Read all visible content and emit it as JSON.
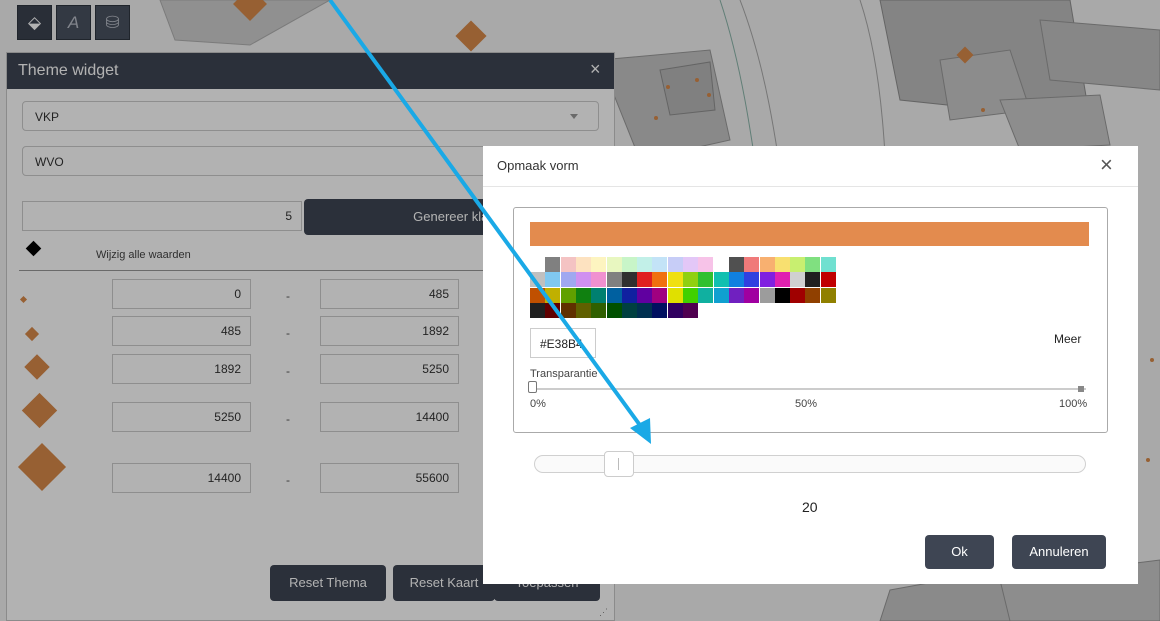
{
  "toolbar": {
    "icons": [
      "theme-icon",
      "label-icon",
      "database-icon"
    ]
  },
  "theme_widget": {
    "title": "Theme widget",
    "close": "×",
    "layer_select": "VKP",
    "field_select": "WVO",
    "class_count": "5",
    "generate_label": "Genereer klas",
    "change_all_label": "Wijzig alle waarden",
    "separator": "-",
    "classes": [
      {
        "from": "0",
        "to": "485"
      },
      {
        "from": "485",
        "to": "1892"
      },
      {
        "from": "1892",
        "to": "5250"
      },
      {
        "from": "5250",
        "to": "14400"
      },
      {
        "from": "14400",
        "to": "55600"
      }
    ],
    "reset_theme_label": "Reset Thema",
    "reset_map_label": "Reset Kaart",
    "apply_label": "Toepassen"
  },
  "dialog": {
    "title": "Opmaak vorm",
    "close": "×",
    "selected_color": "#E38B4E",
    "hex_value": "#E38B4",
    "more_label": "Meer",
    "transparency_label": "Transparantie",
    "scale_min": "0%",
    "scale_mid": "50%",
    "scale_max": "100%",
    "transparency_value": 0,
    "slider_value": "20",
    "ok_label": "Ok",
    "cancel_label": "Annuleren",
    "palette_rows": [
      [
        "#ffffff",
        "#808080",
        "#f4c3c3",
        "#fde2c0",
        "#fdf4c0",
        "#e8f7c0",
        "#c8f5c8",
        "#c2f0e8",
        "#c3e3f7",
        "#c7cdf7",
        "#e3c7f7",
        "#f7c3e8",
        "#ffffff",
        "#505050",
        "#f07a7a",
        "#f8b070",
        "#f8e070",
        "#c8ef70",
        "#80e080",
        "#70e0d0"
      ],
      [
        "#c0c0c0",
        "#80c8f0",
        "#a0a8f0",
        "#d090f0",
        "#f090d0",
        "#808080",
        "#303030",
        "#e02020",
        "#f07010",
        "#f0e010",
        "#90d010",
        "#30c030",
        "#10c0b0",
        "#1080e0",
        "#3040e0",
        "#8020e0",
        "#e020b0",
        "#d0d0d0",
        "#202020",
        "#c00000"
      ],
      [
        "#c05000",
        "#c0b000",
        "#60a000",
        "#108010",
        "#008070",
        "#0060a0",
        "#1020a0",
        "#6000a0",
        "#a00080",
        "#e0e000",
        "#40d000",
        "#10b0a0",
        "#10a0d0",
        "#7020c0",
        "#a000a0",
        "#9c9c9c",
        "#000000",
        "#a00000",
        "#904000",
        "#908000"
      ],
      [
        "#202020",
        "#600000",
        "#603000",
        "#606000",
        "#306000",
        "#005000",
        "#004040",
        "#003050",
        "#001060",
        "#300060",
        "#500050"
      ]
    ]
  }
}
